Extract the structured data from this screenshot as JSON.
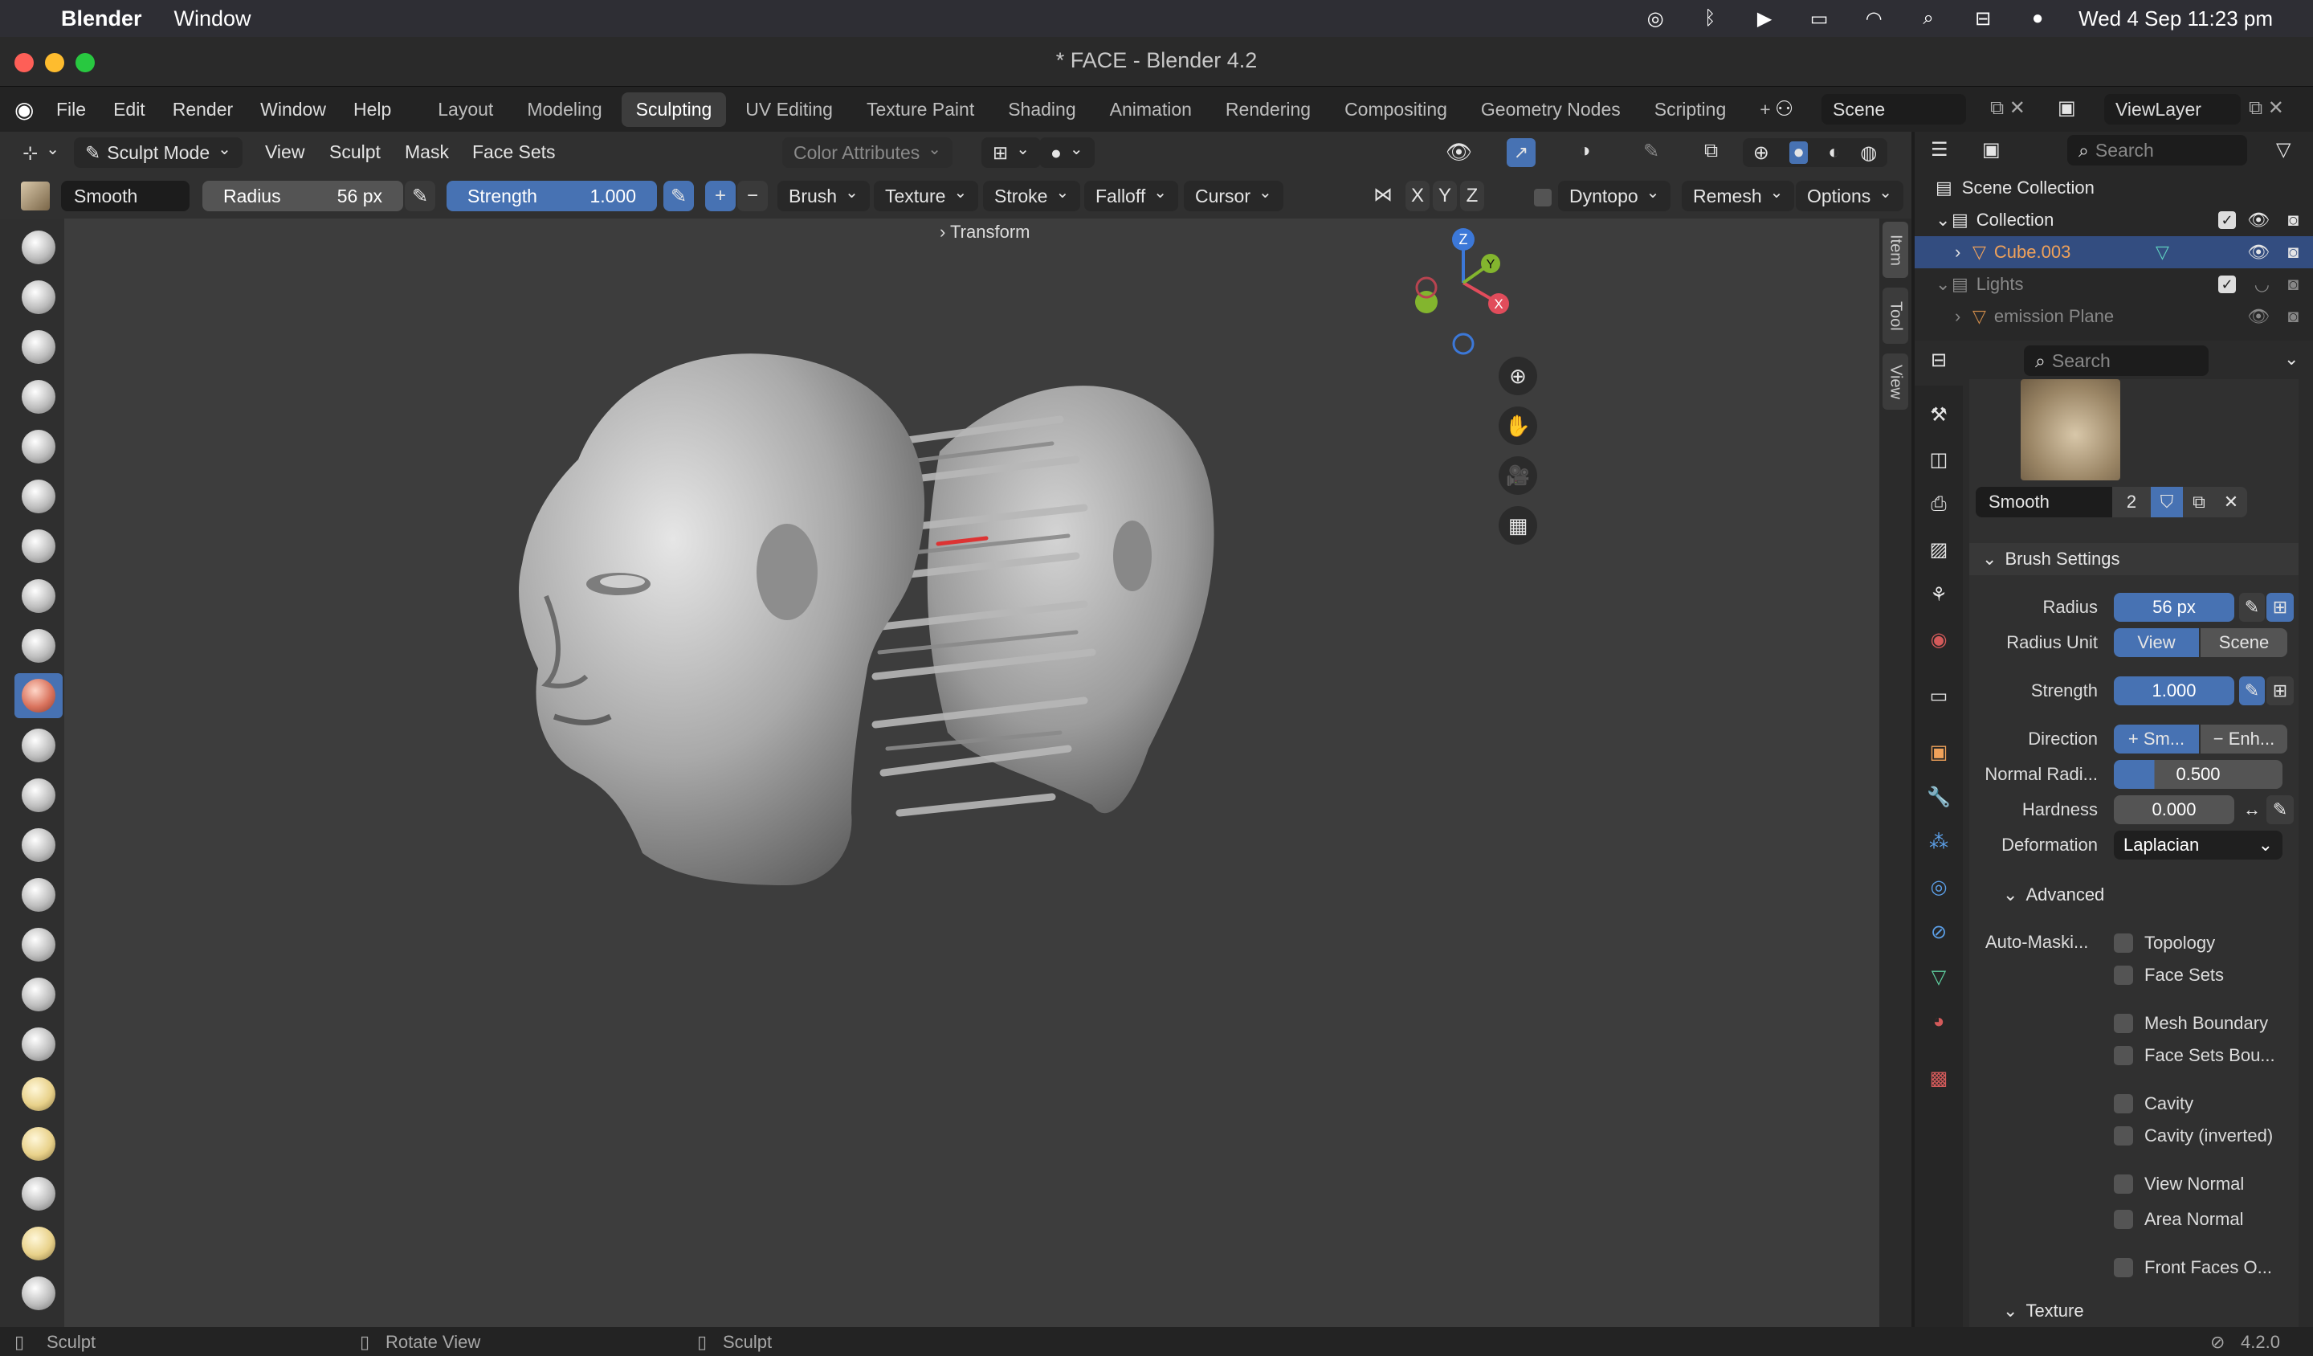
{
  "menubar": {
    "app_name": "Blender",
    "menu_window": "Window",
    "datetime": "Wed 4 Sep  11:23 pm"
  },
  "window": {
    "title": "* FACE - Blender 4.2"
  },
  "topbar": {
    "menus": [
      "File",
      "Edit",
      "Render",
      "Window",
      "Help"
    ],
    "workspaces": [
      "Layout",
      "Modeling",
      "Sculpting",
      "UV Editing",
      "Texture Paint",
      "Shading",
      "Animation",
      "Rendering",
      "Compositing",
      "Geometry Nodes",
      "Scripting"
    ],
    "active_workspace": "Sculpting",
    "scene": "Scene",
    "view_layer": "ViewLayer"
  },
  "header": {
    "mode": "Sculpt Mode",
    "menus": [
      "View",
      "Sculpt",
      "Mask",
      "Face Sets"
    ],
    "color_attributes": "Color Attributes"
  },
  "tool_settings": {
    "brush_name": "Smooth",
    "radius_label": "Radius",
    "radius_value": "56 px",
    "strength_label": "Strength",
    "strength_value": "1.000",
    "menus": [
      "Brush",
      "Texture",
      "Stroke",
      "Falloff",
      "Cursor"
    ],
    "axes": [
      "X",
      "Y",
      "Z"
    ],
    "dyntopo": "Dyntopo",
    "remesh": "Remesh",
    "options": "Options"
  },
  "viewport": {
    "transform_label": "Transform",
    "gizmo_axes": [
      "Z",
      "Y",
      "X"
    ],
    "side_tabs": [
      "Item",
      "Tool",
      "View"
    ]
  },
  "outliner": {
    "search_placeholder": "Search",
    "scene_collection": "Scene Collection",
    "items": [
      {
        "label": "Collection"
      },
      {
        "label": "Cube.003"
      },
      {
        "label": "Lights"
      },
      {
        "label": "emission Plane"
      }
    ]
  },
  "properties": {
    "search_placeholder": "Search",
    "brush_name": "Smooth",
    "brush_users": "2",
    "brush_settings_title": "Brush Settings",
    "radius_label": "Radius",
    "radius_value": "56 px",
    "radius_unit_label": "Radius Unit",
    "radius_unit_view": "View",
    "radius_unit_scene": "Scene",
    "strength_label": "Strength",
    "strength_value": "1.000",
    "direction_label": "Direction",
    "direction_smooth": "Sm...",
    "direction_enhance": "Enh...",
    "normal_radius_label": "Normal Radi...",
    "normal_radius_value": "0.500",
    "hardness_label": "Hardness",
    "hardness_value": "0.000",
    "deformation_label": "Deformation",
    "deformation_value": "Laplacian",
    "advanced_title": "Advanced",
    "auto_masking_label": "Auto-Maski...",
    "auto_masking": [
      "Topology",
      "Face Sets",
      "Mesh Boundary",
      "Face Sets Bou...",
      "Cavity",
      "Cavity (inverted)",
      "View Normal",
      "Area Normal",
      "Front Faces O..."
    ],
    "texture_title": "Texture"
  },
  "statusbar": {
    "left": "Sculpt",
    "middle": "Rotate View",
    "right": "Sculpt",
    "version": "4.2.0"
  },
  "colors": {
    "accent": "#4772b3",
    "viewport_bg": "#3d3d3d",
    "panel_bg": "#303030",
    "selected_text": "#f0a25a"
  }
}
